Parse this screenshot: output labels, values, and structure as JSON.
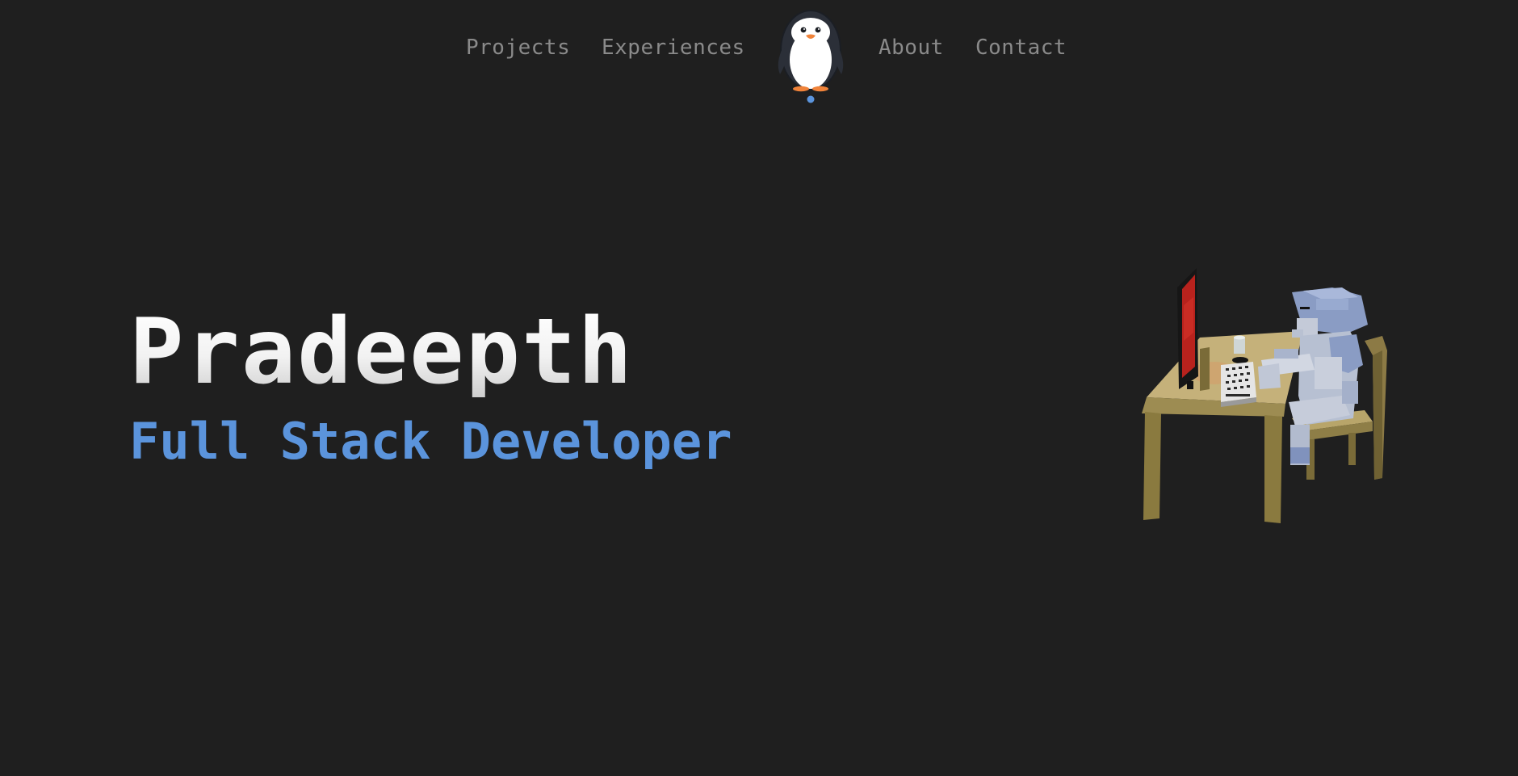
{
  "nav": {
    "links": [
      {
        "label": "Projects"
      },
      {
        "label": "Experiences"
      },
      {
        "label": "About"
      },
      {
        "label": "Contact"
      }
    ],
    "logo_icon": "penguin-icon",
    "active_indicator_color": "#5b94dc"
  },
  "hero": {
    "name": "Pradeepth",
    "role": "Full Stack Developer",
    "accent_color": "#5b94dc",
    "illustration": "voxel-developer-at-desk"
  },
  "theme": {
    "background": "#1f1f1f",
    "nav_text": "#8a8a8a"
  }
}
